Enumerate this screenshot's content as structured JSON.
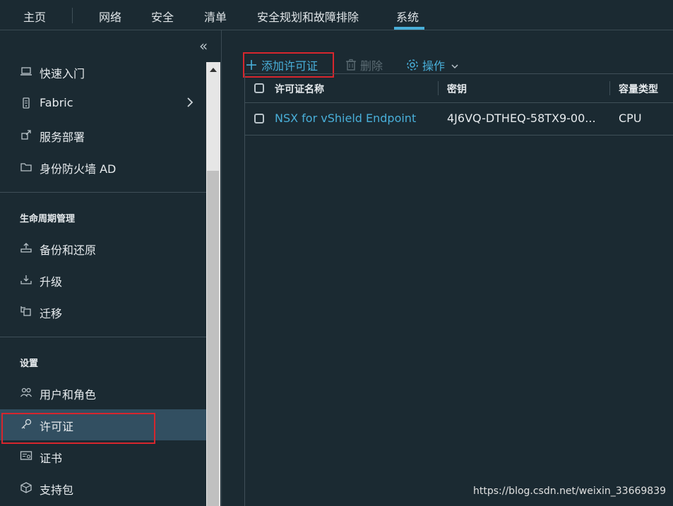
{
  "topnav": {
    "items": [
      "主页",
      "网络",
      "安全",
      "清单",
      "安全规划和故障排除",
      "系统"
    ],
    "active": "系统"
  },
  "sidebar": {
    "collapse_glyph": "«",
    "items_top": [
      {
        "label": "快速入门",
        "icon": "laptop-icon"
      },
      {
        "label": "Fabric",
        "icon": "server-icon",
        "has_submenu": true
      },
      {
        "label": "服务部署",
        "icon": "deploy-icon"
      },
      {
        "label": "身份防火墙 AD",
        "icon": "folder-icon"
      }
    ],
    "section_lifecycle": "生命周期管理",
    "items_lifecycle": [
      {
        "label": "备份和还原",
        "icon": "backup-icon"
      },
      {
        "label": "升级",
        "icon": "upgrade-icon"
      },
      {
        "label": "迁移",
        "icon": "migrate-icon"
      }
    ],
    "section_settings": "设置",
    "items_settings": [
      {
        "label": "用户和角色",
        "icon": "users-icon"
      },
      {
        "label": "许可证",
        "icon": "key-icon",
        "active": true
      },
      {
        "label": "证书",
        "icon": "certificate-icon"
      },
      {
        "label": "支持包",
        "icon": "package-icon"
      }
    ]
  },
  "toolbar": {
    "add_label": "添加许可证",
    "delete_label": "删除",
    "actions_label": "操作"
  },
  "grid": {
    "headers": [
      "许可证名称",
      "密钥",
      "容量类型"
    ],
    "rows": [
      {
        "name": "NSX for vShield Endpoint",
        "key": "4J6VQ-DTHEQ-58TX9-00...",
        "capacity": "CPU"
      }
    ]
  },
  "watermark": "https://blog.csdn.net/weixin_33669839",
  "colors": {
    "background": "#1b2a32",
    "accent": "#49afd9",
    "link": "#49afd9",
    "active_row": "#324f61",
    "highlight_box": "#d7262d"
  }
}
